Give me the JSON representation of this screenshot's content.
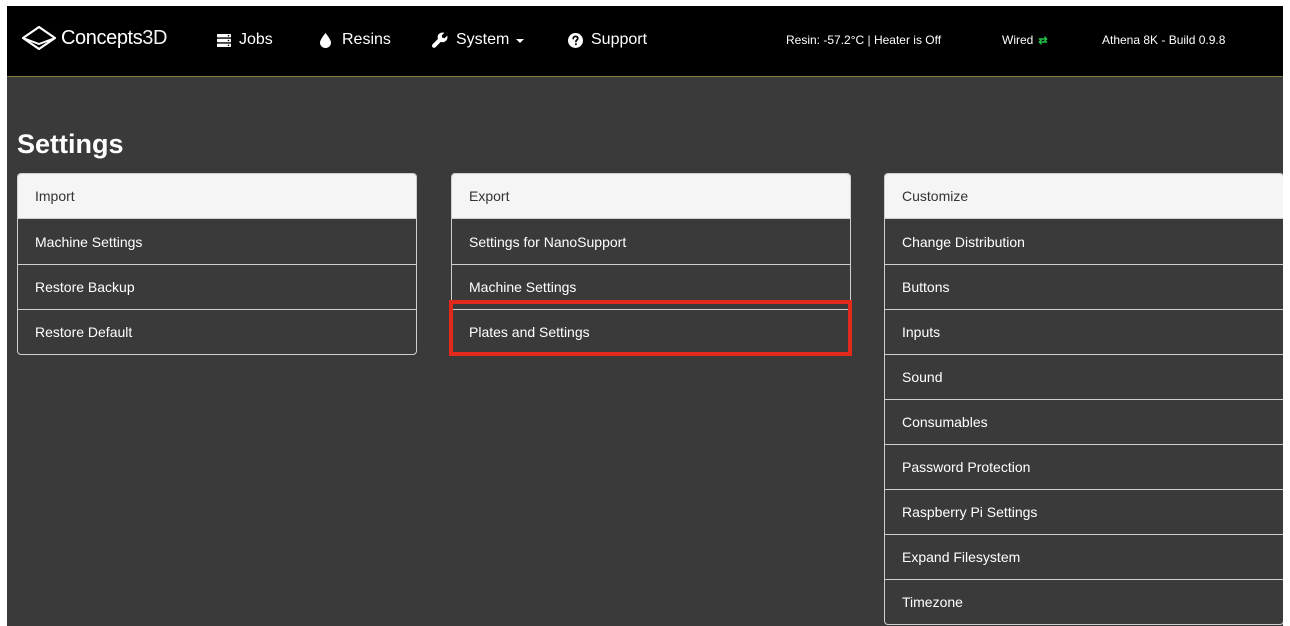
{
  "navbar": {
    "brand": {
      "main": "Concepts",
      "suffix": "3D"
    },
    "items": [
      {
        "label": "Jobs",
        "icon": "server-icon"
      },
      {
        "label": "Resins",
        "icon": "droplet-icon"
      },
      {
        "label": "System",
        "icon": "wrench-icon",
        "dropdown": true
      },
      {
        "label": "Support",
        "icon": "question-circle-icon"
      }
    ],
    "resin_status": "Resin: -57.2°C | Heater is Off",
    "network": {
      "label": "Wired",
      "icon": "exchange-arrows-icon",
      "color": "#22c04a"
    },
    "build": "Athena 8K - Build 0.9.8"
  },
  "page": {
    "title": "Settings"
  },
  "panels": {
    "import": {
      "heading": "Import",
      "items": [
        "Machine Settings",
        "Restore Backup",
        "Restore Default"
      ]
    },
    "export": {
      "heading": "Export",
      "items": [
        "Settings for NanoSupport",
        "Machine Settings",
        "Plates and Settings"
      ],
      "highlighted_item": "Plates and Settings"
    },
    "customize": {
      "heading": "Customize",
      "items": [
        "Change Distribution",
        "Buttons",
        "Inputs",
        "Sound",
        "Consumables",
        "Password Protection",
        "Raspberry Pi Settings",
        "Expand Filesystem",
        "Timezone"
      ]
    }
  },
  "colors": {
    "navbar_bg": "#000000",
    "page_bg": "#3a3a3a",
    "heading_bg": "#f5f5f5",
    "highlight": "#e12a1c",
    "accent_line": "#8a7a43"
  }
}
